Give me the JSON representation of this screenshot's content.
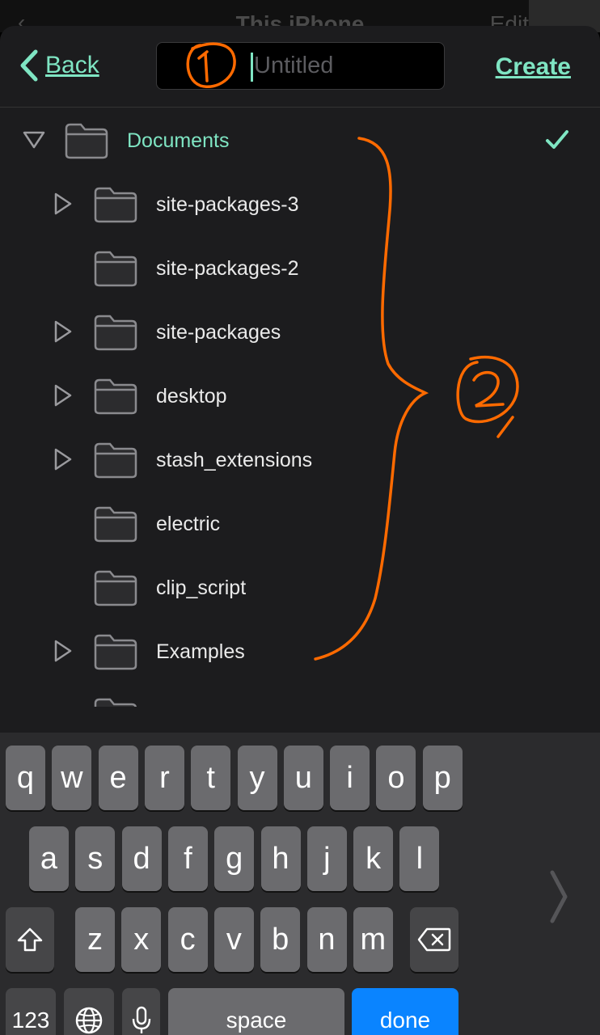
{
  "behind": {
    "title": "This iPhone",
    "edit_label": "Edit"
  },
  "navbar": {
    "back_label": "Back",
    "name_placeholder": "Untitled",
    "name_value": "",
    "create_label": "Create"
  },
  "tree": {
    "root": {
      "label": "Documents",
      "expanded": true,
      "selected": true
    },
    "items": [
      {
        "label": "site-packages-3",
        "has_children": true
      },
      {
        "label": "site-packages-2",
        "has_children": false
      },
      {
        "label": "site-packages",
        "has_children": true
      },
      {
        "label": "desktop",
        "has_children": true
      },
      {
        "label": "stash_extensions",
        "has_children": true
      },
      {
        "label": "electric",
        "has_children": false
      },
      {
        "label": "clip_script",
        "has_children": false
      },
      {
        "label": "Examples",
        "has_children": true
      }
    ]
  },
  "keyboard": {
    "row1": [
      "q",
      "w",
      "e",
      "r",
      "t",
      "y",
      "u",
      "i",
      "o",
      "p"
    ],
    "row2": [
      "a",
      "s",
      "d",
      "f",
      "g",
      "h",
      "j",
      "k",
      "l"
    ],
    "row3": [
      "z",
      "x",
      "c",
      "v",
      "b",
      "n",
      "m"
    ],
    "numbers_label": "123",
    "space_label": "space",
    "done_label": "done"
  },
  "annotations": {
    "one": "1",
    "two": "2",
    "color": "#ff6a00"
  },
  "colors": {
    "accent": "#7fe5c3",
    "done_key": "#0a84ff"
  }
}
